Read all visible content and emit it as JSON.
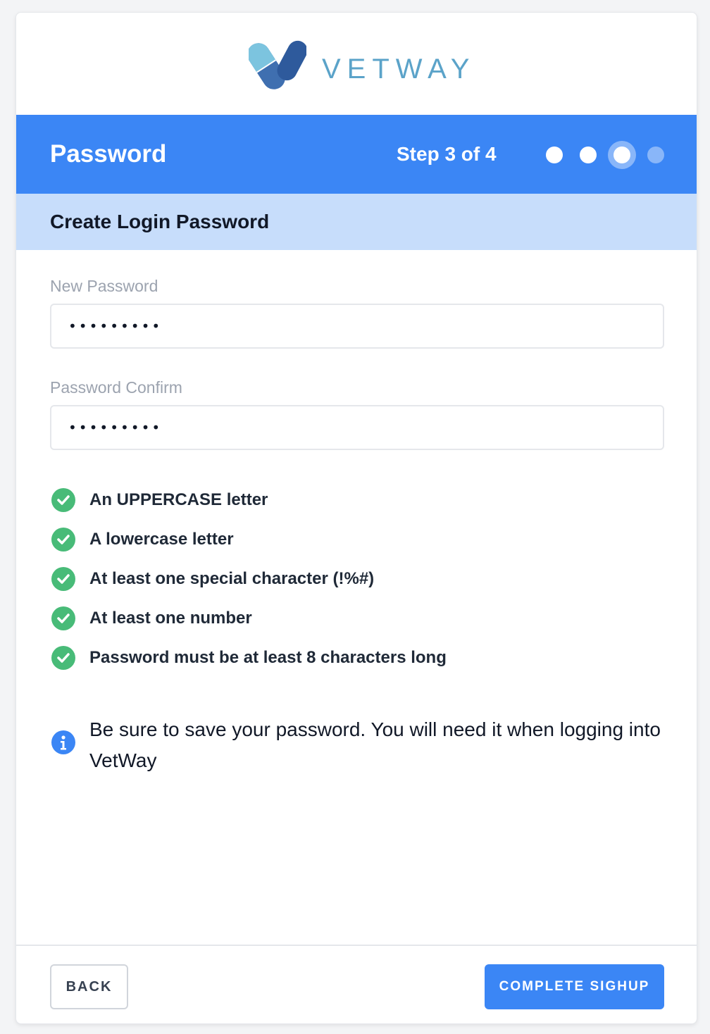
{
  "brand": {
    "name": "VETWAY",
    "colors": {
      "pill_light": "#7cc4df",
      "pill_dark": "#2e5a9c",
      "pill_mid": "#3f6fb0",
      "text": "#5ba3c9"
    }
  },
  "step_header": {
    "title": "Password",
    "step_text": "Step 3 of 4",
    "current_step": 3,
    "total_steps": 4,
    "accent": "#3b86f5"
  },
  "subheader": {
    "title": "Create Login Password"
  },
  "form": {
    "new_password": {
      "label": "New Password",
      "value": "•••••••••"
    },
    "password_confirm": {
      "label": "Password Confirm",
      "value": "•••••••••"
    }
  },
  "requirements": [
    {
      "text": "An UPPERCASE letter",
      "met": true,
      "icon": "check-circle-icon"
    },
    {
      "text": "A lowercase letter",
      "met": true,
      "icon": "check-circle-icon"
    },
    {
      "text": "At least one special character (!%#)",
      "met": true,
      "icon": "check-circle-icon"
    },
    {
      "text": "At least one number",
      "met": true,
      "icon": "check-circle-icon"
    },
    {
      "text": "Password must be at least 8 characters long",
      "met": true,
      "icon": "check-circle-icon"
    }
  ],
  "info": {
    "icon": "info-icon",
    "text": "Be sure to save your password. You will need it when logging into VetWay"
  },
  "footer": {
    "back_label": "BACK",
    "complete_label": "COMPLETE SIGHUP"
  }
}
